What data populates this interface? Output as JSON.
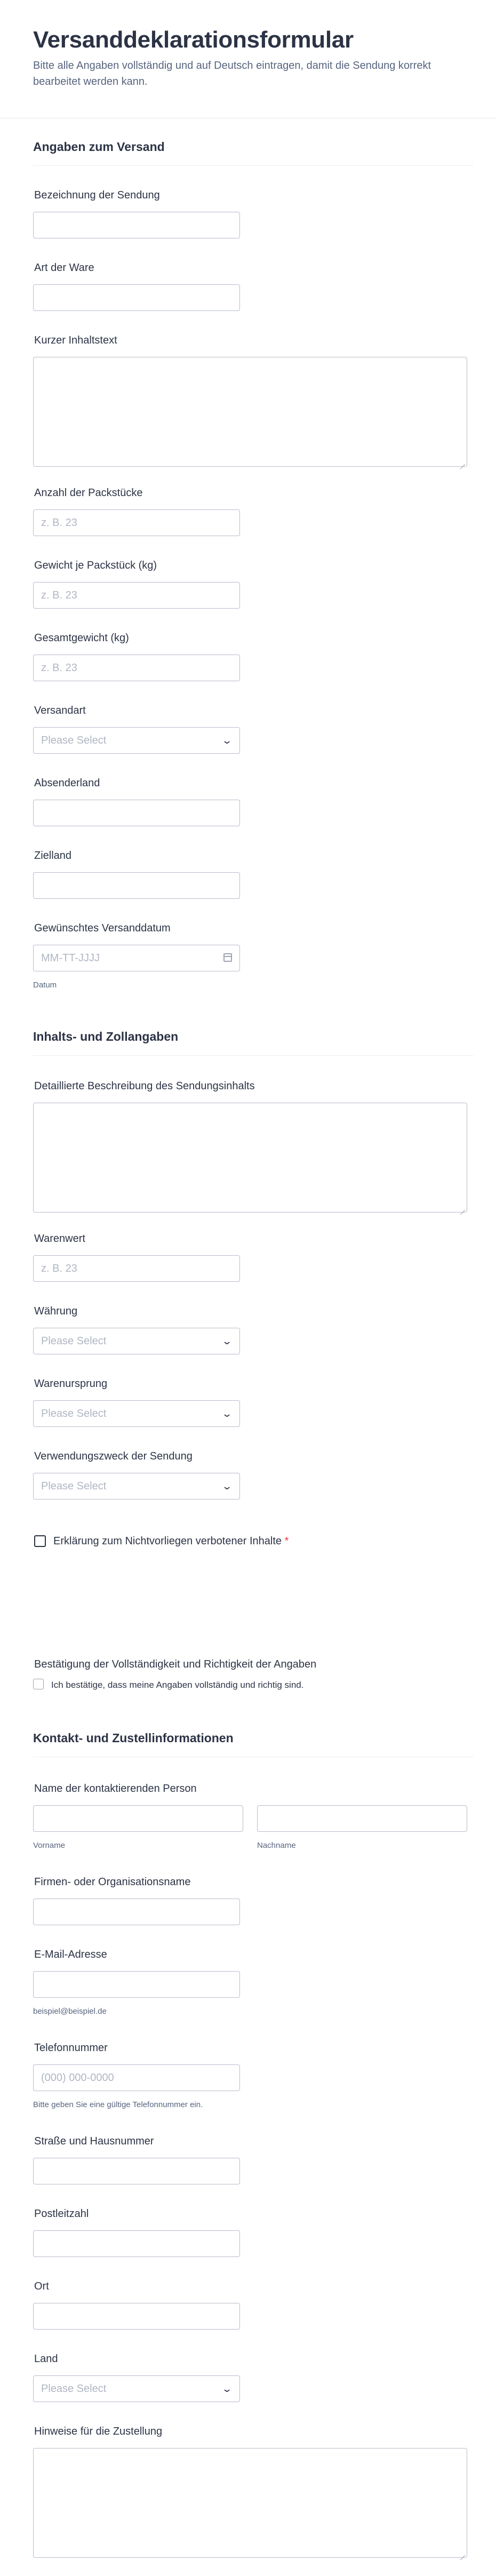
{
  "header": {
    "title": "Versanddeklarationsformular",
    "description": "Bitte alle Angaben vollständig und auf Deutsch eintragen, damit die Sendung korrekt bearbeitet werden kann."
  },
  "sections": {
    "versand": "Angaben zum Versand",
    "inhalt": "Inhalts- und Zollangaben",
    "kontakt": "Kontakt- und Zustellinformationen"
  },
  "fields": {
    "bezeichnung": {
      "label": "Bezeichnung der Sendung",
      "value": ""
    },
    "art": {
      "label": "Art der Ware",
      "value": ""
    },
    "kurztext": {
      "label": "Kurzer Inhaltstext",
      "value": ""
    },
    "anzahl": {
      "label": "Anzahl der Packstücke",
      "placeholder": "z. B. 23"
    },
    "gewicht_je": {
      "label": "Gewicht je Packstück (kg)",
      "placeholder": "z. B. 23"
    },
    "gesamtgewicht": {
      "label": "Gesamtgewicht (kg)",
      "placeholder": "z. B. 23"
    },
    "versandart": {
      "label": "Versandart",
      "selected": "Please Select"
    },
    "absenderland": {
      "label": "Absenderland",
      "value": ""
    },
    "zielland": {
      "label": "Zielland",
      "value": ""
    },
    "versanddatum": {
      "label": "Gewünschtes Versanddatum",
      "placeholder": "MM-TT-JJJJ",
      "sublabel": "Datum"
    },
    "beschreibung": {
      "label": "Detaillierte Beschreibung des Sendungsinhalts",
      "value": ""
    },
    "warenwert": {
      "label": "Warenwert",
      "placeholder": "z. B. 23"
    },
    "waehrung": {
      "label": "Währung",
      "selected": "Please Select"
    },
    "warenursprung": {
      "label": "Warenursprung",
      "selected": "Please Select"
    },
    "verwendungszweck": {
      "label": "Verwendungszweck der Sendung",
      "selected": "Please Select"
    },
    "erklaerung": {
      "label": "Erklärung zum Nichtvorliegen verbotener Inhalte",
      "required_mark": "*"
    },
    "bestaetigung": {
      "label": "Bestätigung der Vollständigkeit und Richtigkeit der Angaben",
      "option": "Ich bestätige, dass meine Angaben vollständig und richtig sind."
    },
    "kontaktperson": {
      "label": "Name der kontaktierenden Person",
      "first_sub": "Vorname",
      "last_sub": "Nachname"
    },
    "firma": {
      "label": "Firmen- oder Organisationsname",
      "value": ""
    },
    "email": {
      "label": "E-Mail-Adresse",
      "sublabel": "beispiel@beispiel.de"
    },
    "telefon": {
      "label": "Telefonnummer",
      "placeholder": "(000) 000-0000",
      "sublabel": "Bitte geben Sie eine gültige Telefonnummer ein."
    },
    "strasse": {
      "label": "Straße und Hausnummer",
      "value": ""
    },
    "plz": {
      "label": "Postleitzahl",
      "value": ""
    },
    "ort": {
      "label": "Ort",
      "value": ""
    },
    "land": {
      "label": "Land",
      "selected": "Please Select"
    },
    "hinweise": {
      "label": "Hinweise für die Zustellung",
      "value": ""
    }
  },
  "icons": {
    "dropdown": "chevron-down-icon",
    "date": "calendar-icon",
    "resize": "resize-handle-icon"
  },
  "colors": {
    "text": "#2c3345",
    "muted": "#57647e",
    "placeholder": "#b0b6c3",
    "border": "#b8bdc9",
    "required": "#f23a3c"
  }
}
